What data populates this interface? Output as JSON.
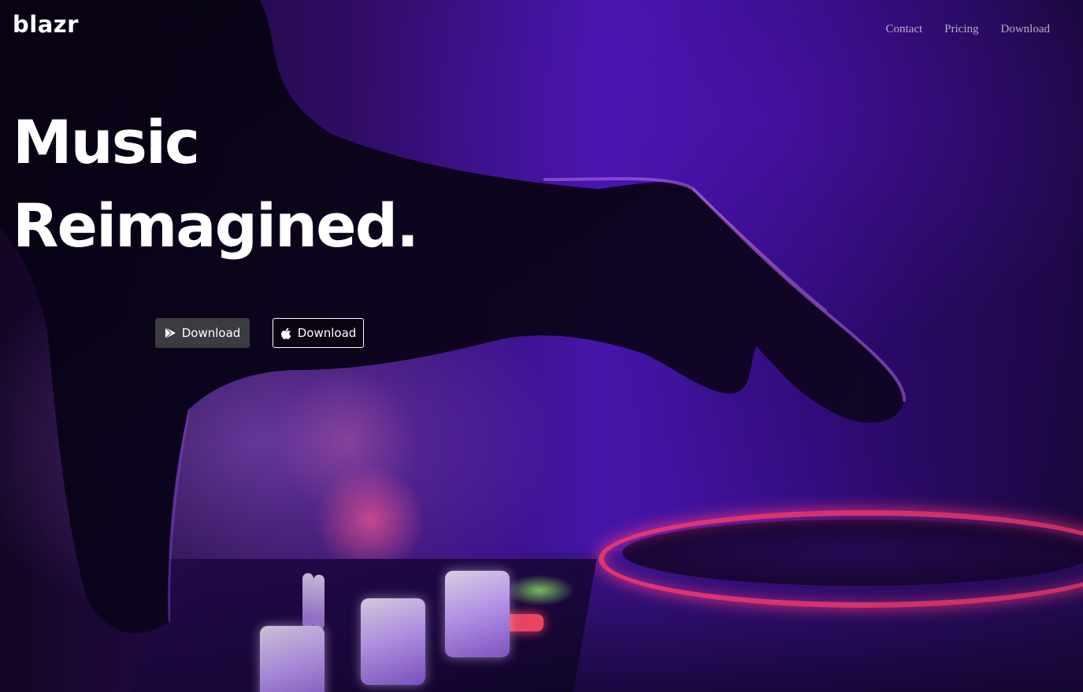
{
  "header": {
    "brand": "blazr",
    "nav": [
      {
        "label": "Contact"
      },
      {
        "label": "Pricing"
      },
      {
        "label": "Download"
      }
    ]
  },
  "hero": {
    "headline_line1": "Music",
    "headline_line2": "Reimagined.",
    "buttons": [
      {
        "label": "Download",
        "icon": "play-store-icon"
      },
      {
        "label": "Download",
        "icon": "apple-icon"
      }
    ]
  },
  "colors": {
    "background_accent": "#4a17b5",
    "text_primary": "#ffffff",
    "nav_text": "#b6b0c4",
    "play_button_bg": "#3a3c40",
    "apple_button_bg": "#0a0412",
    "deck_ring": "#ff3c78"
  }
}
